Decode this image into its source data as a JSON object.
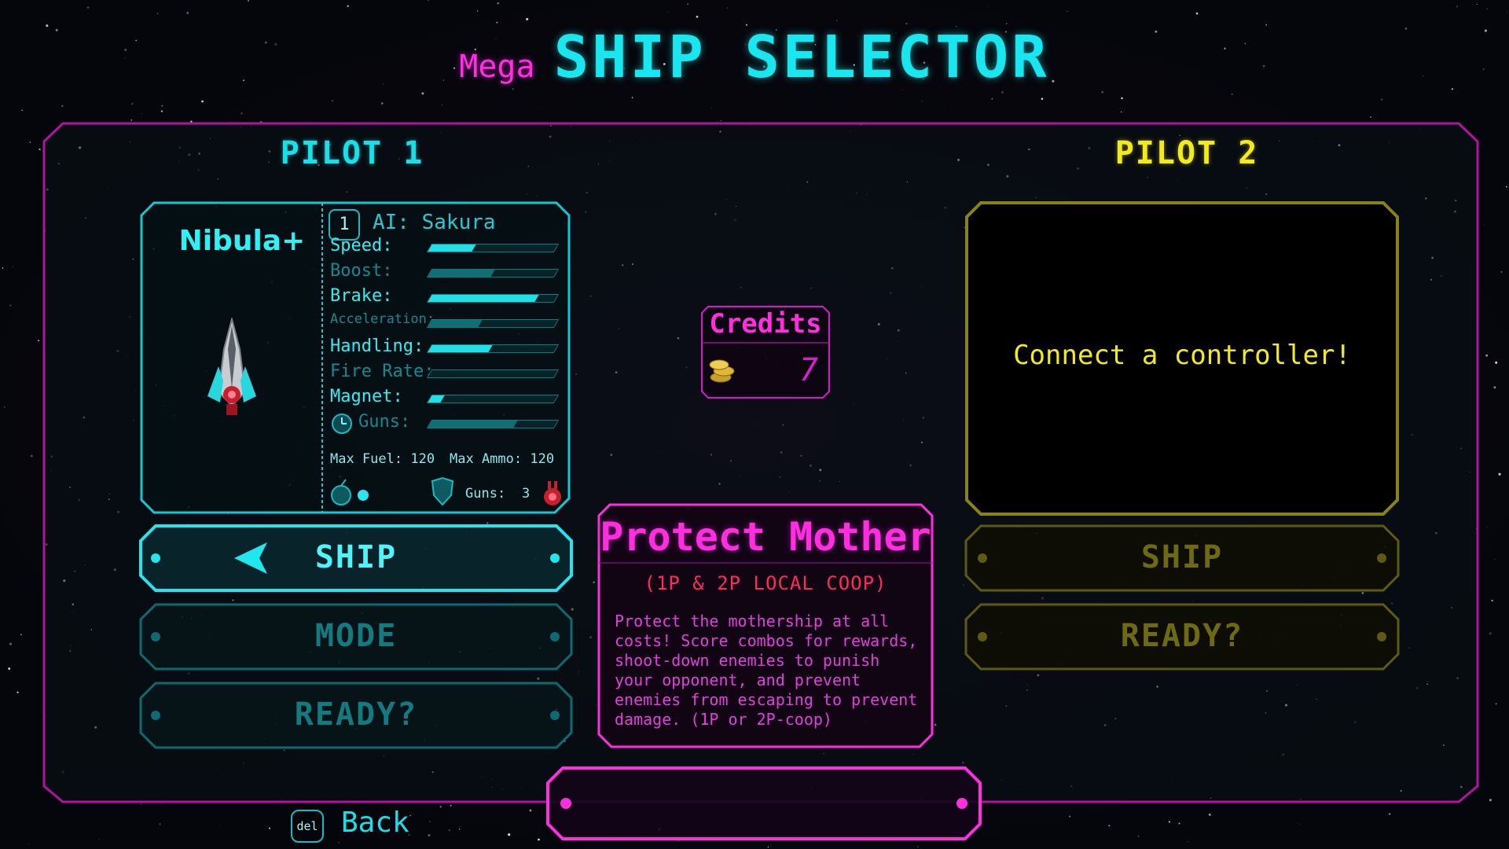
{
  "header": {
    "mega": "Mega",
    "title": "SHIP SELECTOR"
  },
  "pilot1": {
    "heading": "PILOT 1",
    "ship_name": "Nibula+",
    "pilot_number": "1",
    "pilot_name": "AI: Sakura",
    "stats": [
      {
        "label": "Speed:",
        "value": 0.35,
        "bright": true
      },
      {
        "label": "Boost:",
        "value": 0.5,
        "bright": false
      },
      {
        "label": "Brake:",
        "value": 0.85,
        "bright": true
      },
      {
        "label": "Acceleration:",
        "value": 0.4,
        "bright": false
      },
      {
        "label": "Handling:",
        "value": 0.48,
        "bright": true
      },
      {
        "label": "Fire Rate:",
        "value": 0.0,
        "bright": false
      },
      {
        "label": "Magnet:",
        "value": 0.1,
        "bright": true
      },
      {
        "label": "Guns:",
        "value": 0.68,
        "bright": false
      }
    ],
    "max_fuel": "Max Fuel: 120",
    "max_ammo": "Max Ammo: 120",
    "guns": "Guns:",
    "guns_count": "3",
    "buttons": {
      "ship": "SHIP",
      "mode": "MODE",
      "ready": "READY?"
    }
  },
  "credits": {
    "label": "Credits",
    "amount": "7"
  },
  "mode": {
    "title": "Protect Mother",
    "subtitle": "(1P & 2P LOCAL COOP)",
    "description": "Protect the mothership at all costs! Score combos for rewards, shoot-down enemies to punish your opponent, and prevent enemies from escaping to prevent damage. (1P or 2P-coop)"
  },
  "pilot2": {
    "heading": "PILOT 2",
    "message": "Connect a controller!",
    "buttons": {
      "ship": "SHIP",
      "ready": "READY?"
    }
  },
  "footer": {
    "key": "del",
    "back": "Back"
  },
  "colors": {
    "cyan": "#19e0e8",
    "magenta": "#ff2edf",
    "yellow": "#f3ea1c",
    "frame": "#b0139e"
  }
}
